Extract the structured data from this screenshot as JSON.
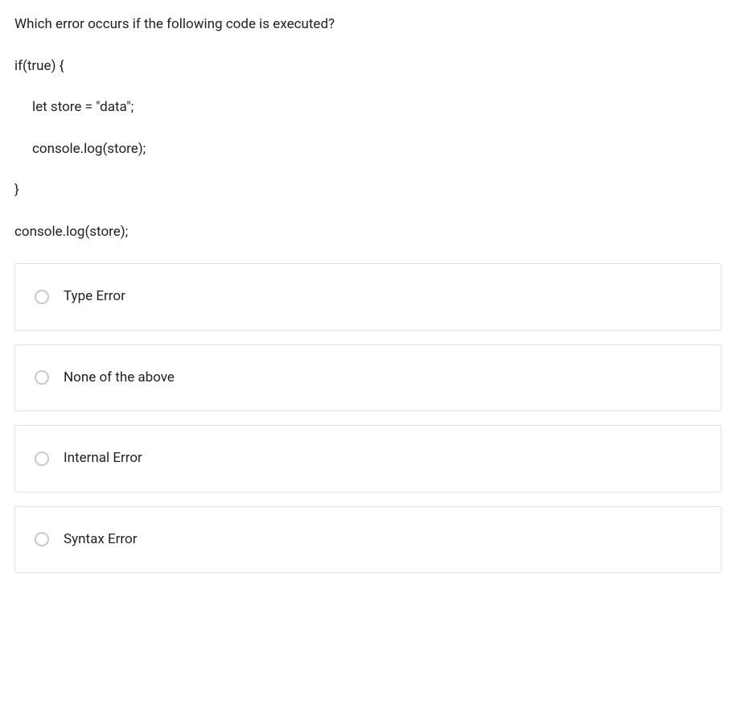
{
  "question": {
    "prompt": "Which error occurs if the following code is executed?",
    "code": {
      "line1": "if(true) {",
      "line2": "let store = \"data\";",
      "line3": "console.log(store);",
      "line4": "}",
      "line5": "console.log(store);"
    }
  },
  "options": [
    {
      "label": "Type Error",
      "selected": false
    },
    {
      "label": "None of the above",
      "selected": false
    },
    {
      "label": "Internal Error",
      "selected": false
    },
    {
      "label": "Syntax Error",
      "selected": false
    }
  ]
}
